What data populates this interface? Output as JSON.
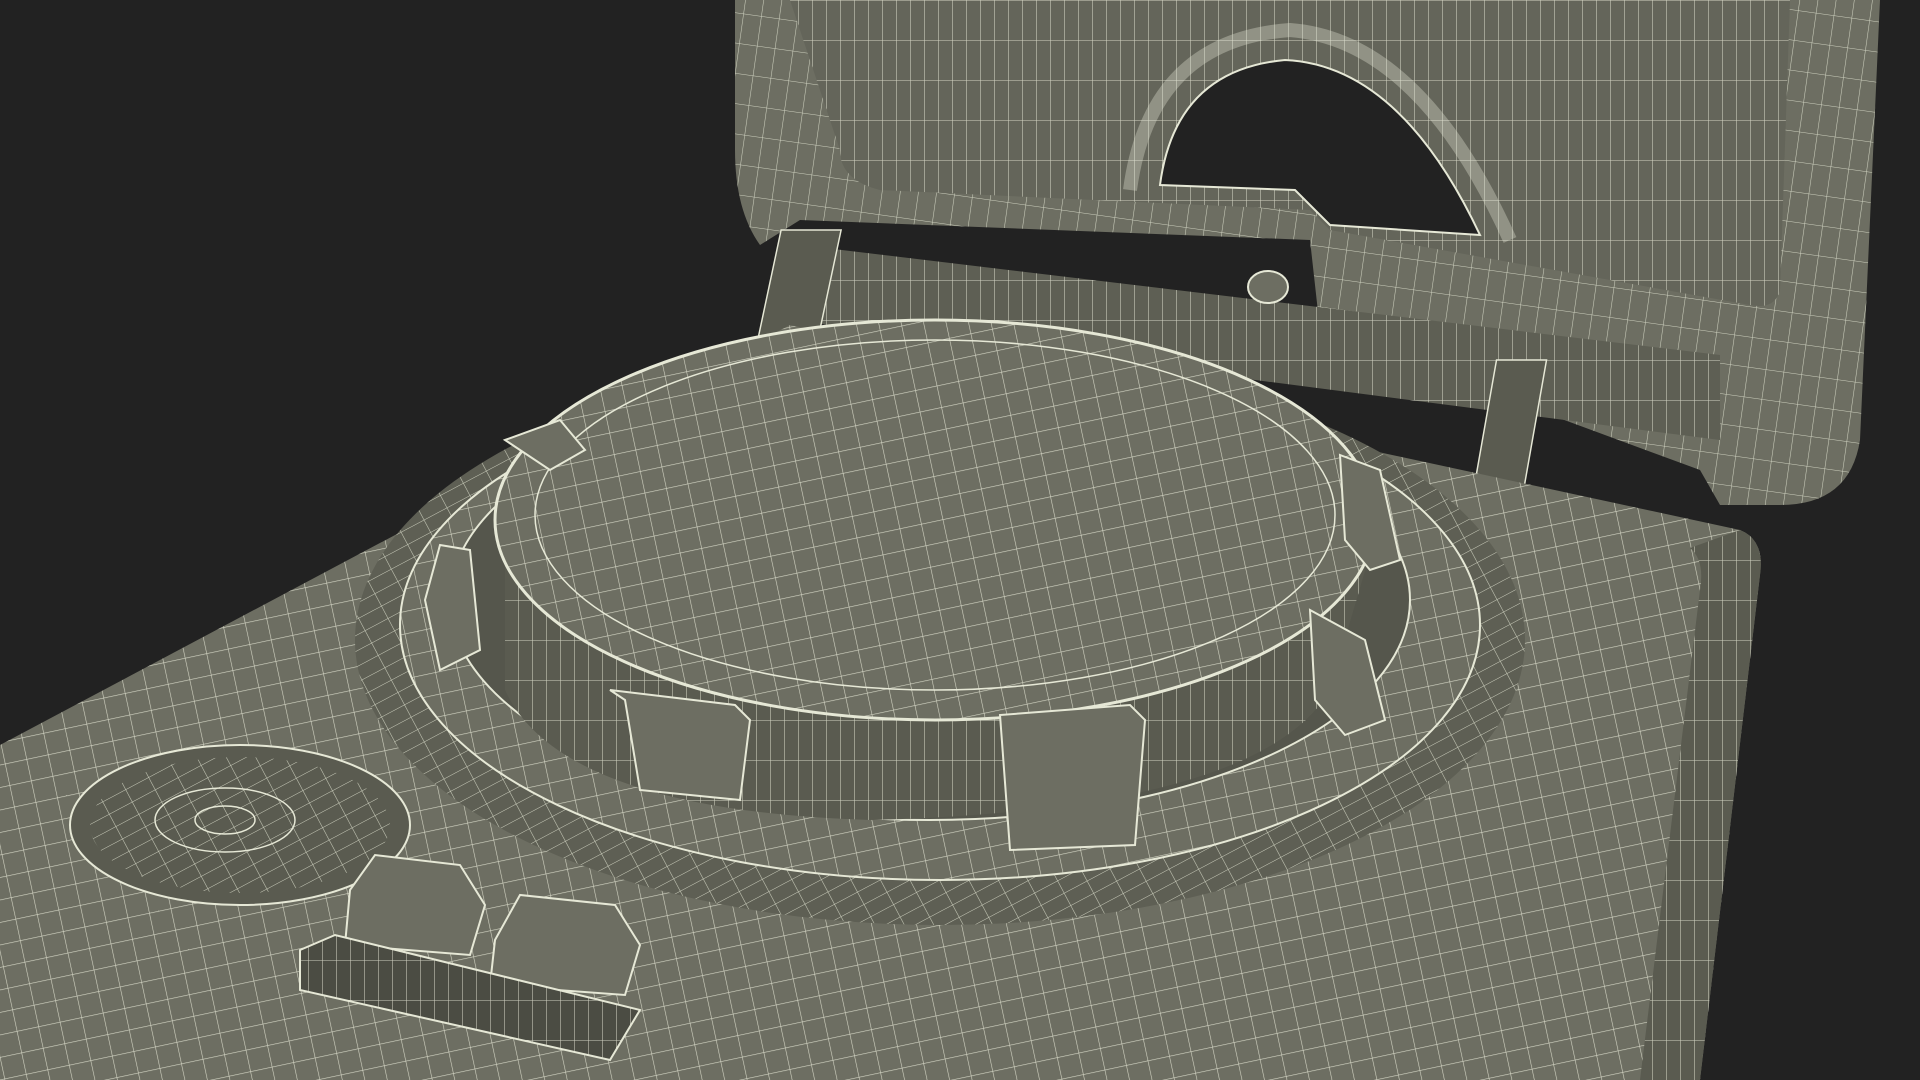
{
  "scene": {
    "subject": "wireframe-3d-model",
    "colors": {
      "background": "#222222",
      "surface": "#6d6e62",
      "surface_dark": "#5a5b50",
      "surface_shadow": "#4b4c43",
      "wire": "#e6e8d6"
    }
  }
}
